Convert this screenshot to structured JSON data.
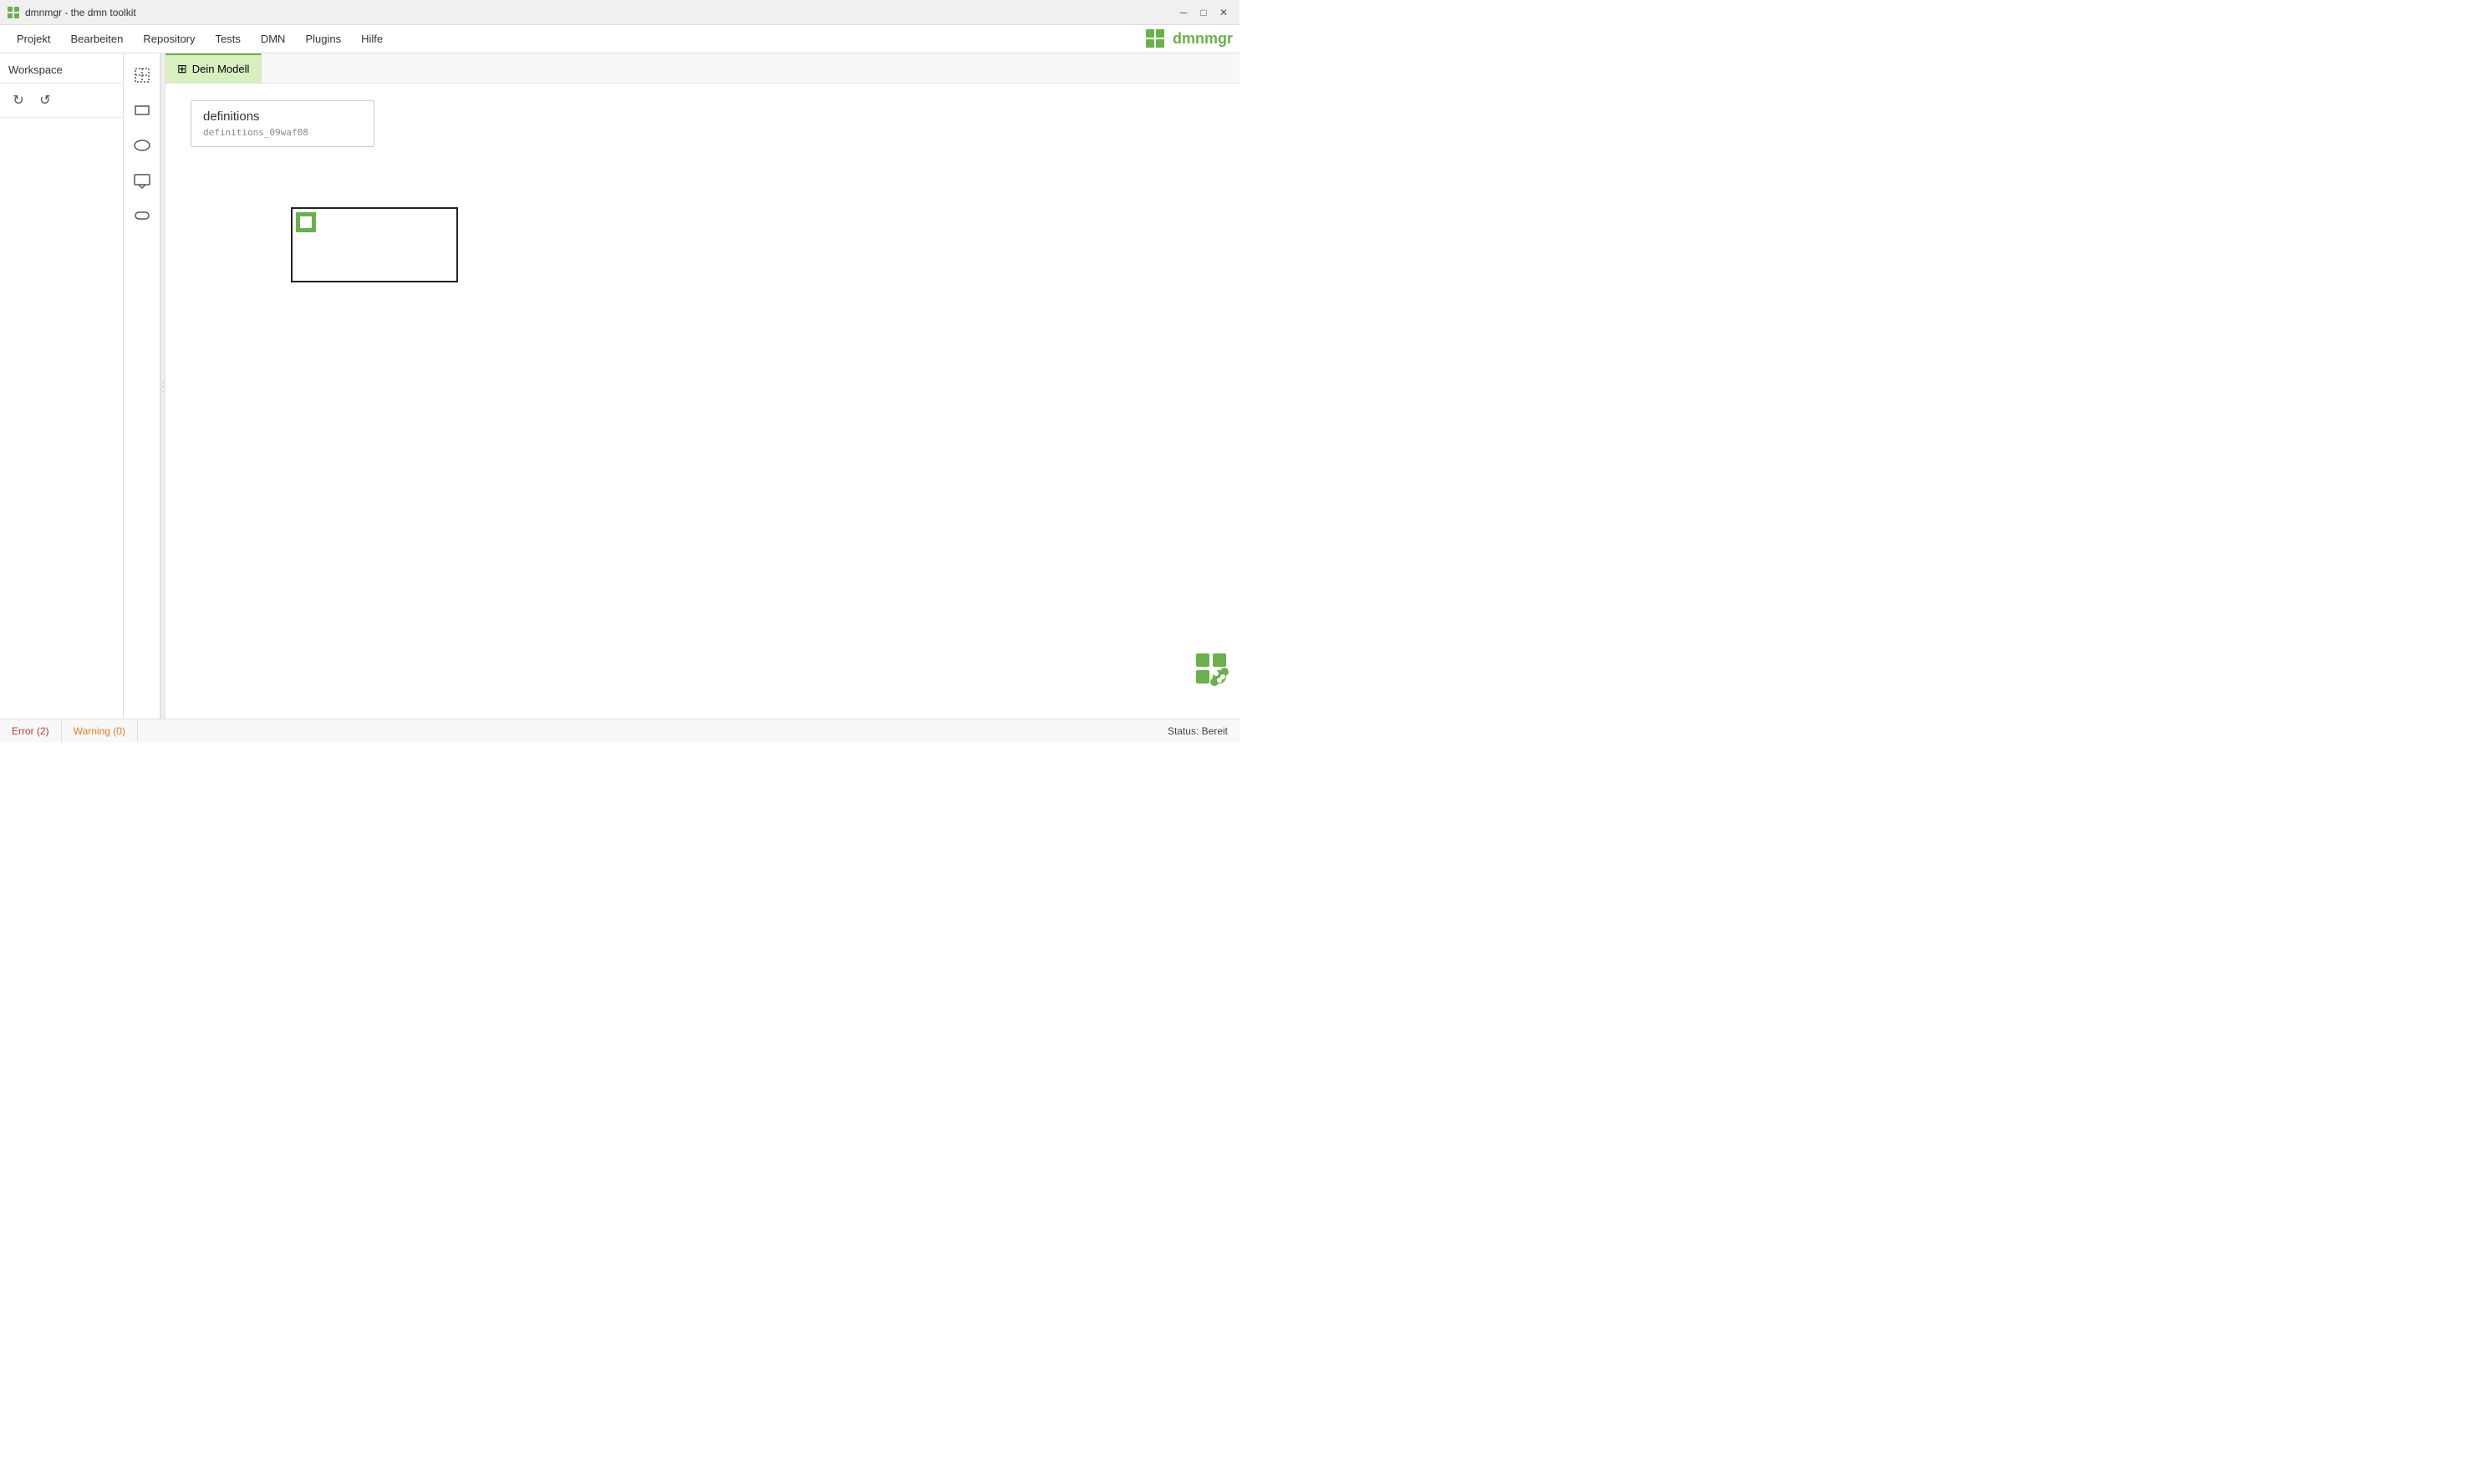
{
  "titleBar": {
    "appName": "dmnmgr - the dmn toolkit",
    "appIconUnicode": "▦",
    "windowControls": {
      "minimize": "─",
      "maximize": "□",
      "close": "✕"
    }
  },
  "menuBar": {
    "items": [
      {
        "label": "Projekt"
      },
      {
        "label": "Bearbeiten"
      },
      {
        "label": "Repository"
      },
      {
        "label": "Tests"
      },
      {
        "label": "DMN"
      },
      {
        "label": "Plugins"
      },
      {
        "label": "Hilfe"
      }
    ],
    "brand": {
      "name": "dmnmgr"
    }
  },
  "sidebar": {
    "header": "Workspace",
    "tools": [
      {
        "name": "refresh",
        "icon": "↻"
      },
      {
        "name": "reset",
        "icon": "↺"
      }
    ]
  },
  "palette": {
    "items": [
      {
        "name": "pointer",
        "type": "select"
      },
      {
        "name": "rectangle",
        "type": "shape"
      },
      {
        "name": "ellipse",
        "type": "shape"
      },
      {
        "name": "message",
        "type": "shape"
      },
      {
        "name": "curved-rect",
        "type": "shape"
      }
    ]
  },
  "canvas": {
    "tab": {
      "icon": "⊞",
      "label": "Dein Modell"
    },
    "definitions": {
      "title": "definitions",
      "id": "definitions_09waf08"
    },
    "decisionElement": {
      "hasTableIcon": true
    }
  },
  "statusBar": {
    "error": "Error (2)",
    "warning": "Warning (0)",
    "status": "Status: Bereit"
  }
}
